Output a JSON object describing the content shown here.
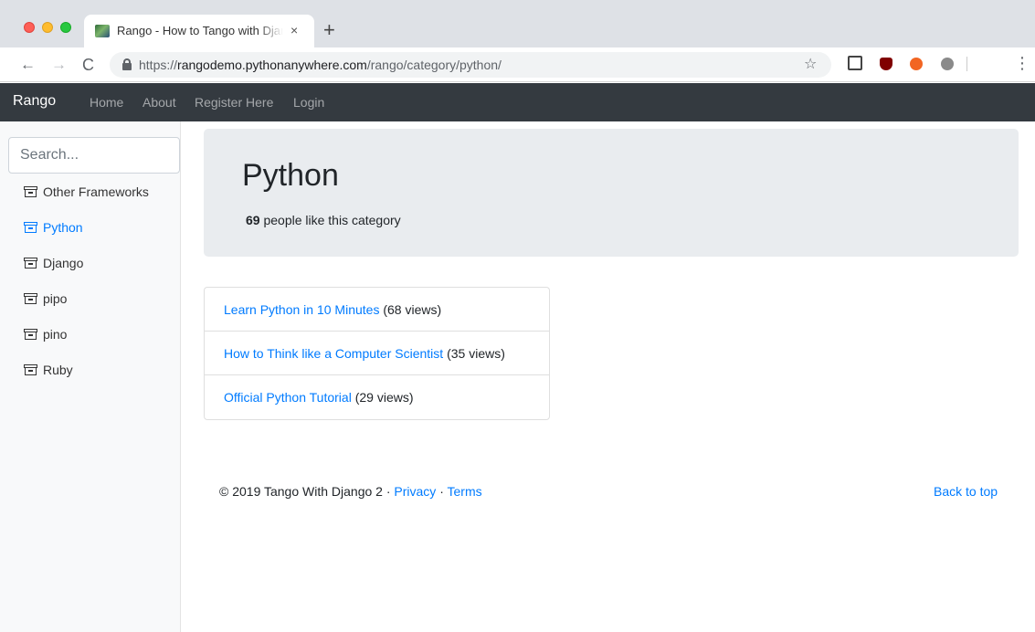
{
  "browser": {
    "tab_title": "Rango - How to Tango with Django",
    "tab_close": "×",
    "new_tab": "+",
    "url_scheme": "https://",
    "url_host": "rangodemo.pythonanywhere.com",
    "url_path": "/rango/category/python/",
    "back": "←",
    "forward": "→",
    "reload": "C",
    "star": "☆",
    "menu": "⋮",
    "icons": [
      "lock-icon",
      "bookmark-star-icon",
      "screen-capture-icon",
      "ublock-icon",
      "extension-orange-icon",
      "extension-gray-icon",
      "menu-dots-icon"
    ],
    "colors": {
      "tabbar": "#dee1e6",
      "omnibox": "#f1f3f4"
    }
  },
  "navbar": {
    "brand": "Rango",
    "links": [
      {
        "label": "Home"
      },
      {
        "label": "About"
      },
      {
        "label": "Register Here"
      },
      {
        "label": "Login"
      }
    ],
    "colors": {
      "background": "#343a40"
    }
  },
  "sidebar": {
    "search_placeholder": "Search...",
    "categories": [
      {
        "label": "Other Frameworks",
        "active": false
      },
      {
        "label": "Python",
        "active": true
      },
      {
        "label": "Django",
        "active": false
      },
      {
        "label": "pipo",
        "active": false
      },
      {
        "label": "pino",
        "active": false
      },
      {
        "label": "Ruby",
        "active": false
      }
    ],
    "category_icon": "archive-box-icon"
  },
  "category": {
    "title": "Python",
    "likes_count": "69",
    "likes_text": "people like this category"
  },
  "pages": [
    {
      "title": "Learn Python in 10 Minutes",
      "views": "(68 views)"
    },
    {
      "title": "How to Think like a Computer Scientist",
      "views": "(35 views)"
    },
    {
      "title": "Official Python Tutorial",
      "views": "(29 views)"
    }
  ],
  "footer": {
    "copyright": "© 2019 Tango With Django 2 · ",
    "privacy": "Privacy",
    "separator": " · ",
    "terms": "Terms",
    "back_to_top": "Back to top"
  },
  "colors": {
    "link": "#007bff",
    "jumbotron": "#e9ecef",
    "sidebar": "#f8f9fa"
  }
}
